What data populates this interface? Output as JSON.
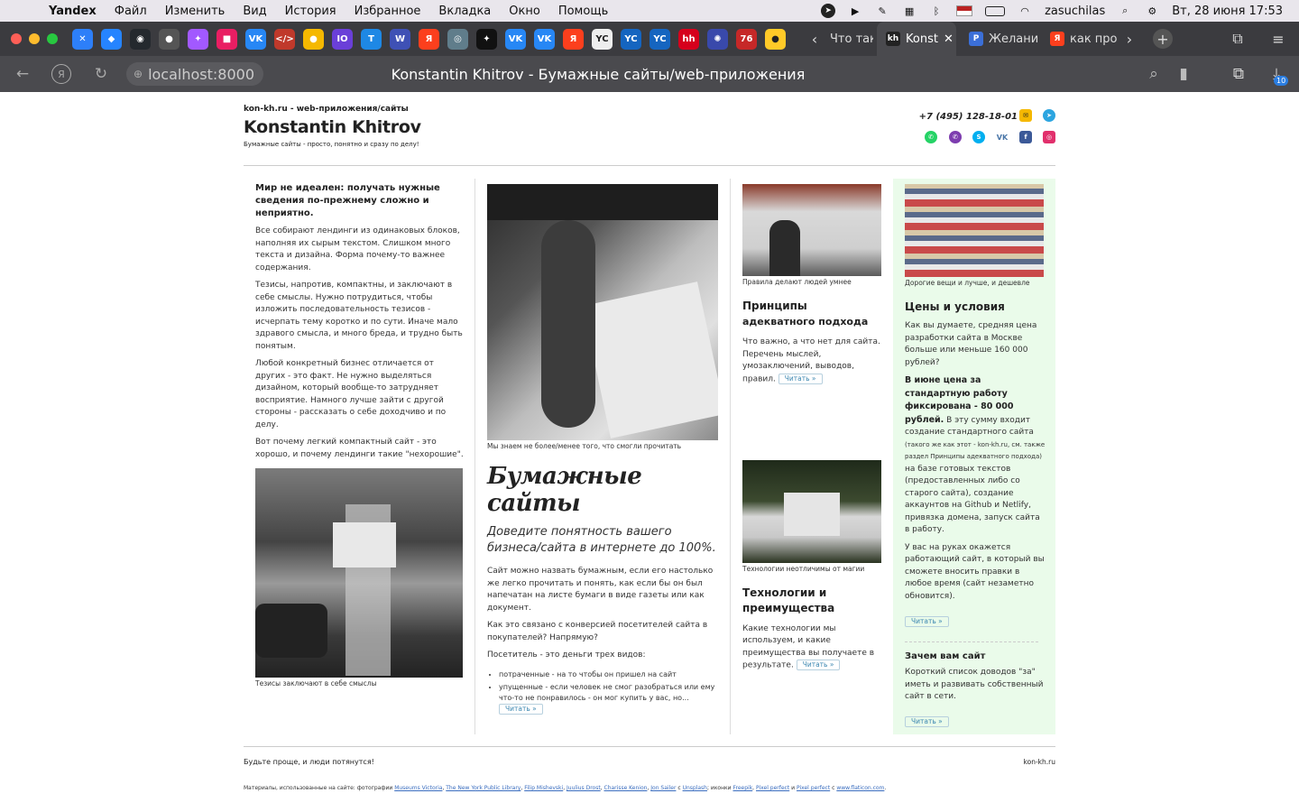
{
  "menubar": {
    "app": "Yandex",
    "items": [
      "Файл",
      "Изменить",
      "Вид",
      "История",
      "Избранное",
      "Вкладка",
      "Окно",
      "Помощь"
    ],
    "user": "zasuchilas",
    "datetime": "Вт, 28 июня  17:53"
  },
  "browser": {
    "tabs": [
      {
        "label": "Что так"
      },
      {
        "label": "Konst"
      },
      {
        "label": "Желани"
      },
      {
        "label": "как про"
      }
    ],
    "url": "localhost:8000",
    "page_title": "Konstantin Khitrov - Бумажные сайты/web-приложения",
    "downloads_badge": "10"
  },
  "site": {
    "domain_line": "kon-kh.ru - web-приложения/сайты",
    "name": "Konstantin Khitrov",
    "tagline": "Бумажные сайты - просто, понятно и сразу по делу!",
    "phone": "+7 (495) 128-18-01"
  },
  "col1": {
    "lead": "Мир не идеален: получать нужные сведения по-прежнему сложно и неприятно.",
    "p1": "Все собирают лендинги из одинаковых блоков, наполняя их сырым текстом. Слишком много текста и дизайна. Форма почему-то важнее содержания.",
    "p2": "Тезисы, напротив, компактны, и заключают в себе смыслы. Нужно потрудиться, чтобы изложить последовательность тезисов - исчерпать тему коротко и по сути. Иначе мало здравого смысла, и много бреда, и трудно быть понятым.",
    "p3": "Любой конкретный бизнес отличается от других - это факт. Не нужно выделяться дизайном, который вообще-то затрудняет восприятие. Намного лучше зайти с другой стороны - рассказать о себе доходчиво и по делу.",
    "p4": "Вот почему легкий компактный сайт - это хорошо, и почему лендинги такие \"нехорошие\".",
    "caption": "Тезисы заключают в себе смыслы"
  },
  "col2": {
    "caption": "Мы знаем не более/менее того, что смогли прочитать",
    "title": "Бумажные сайты",
    "subtitle": "Доведите понятность вашего бизнеса/сайта в интернете до 100%.",
    "p1": "Сайт можно назвать бумажным, если его настолько же легко прочитать и понять, как если бы он был напечатан на листе бумаги в виде газеты или как документ.",
    "p2": "Как это связано с конверсией посетителей сайта в покупателей? Напрямую?",
    "p3": "Посетитель - это деньги трех видов:",
    "li1": "потраченные - на то чтобы он пришел на сайт",
    "li2": "упущенные - если человек не смог разобраться или ему что-то не понравилось - он мог купить у вас, но...",
    "read": "Читать »"
  },
  "col3": {
    "caption1": "Правила делают людей умнее",
    "title1a": "Принципы",
    "title1b": "адекватного подхода",
    "p1": "Что важно, а что нет для сайта. Перечень мыслей, умозаключений, выводов, правил.",
    "read1": "Читать »",
    "caption2": "Технологии неотличимы от магии",
    "title2": "Технологии и преимущества",
    "p2": "Какие технологии мы используем, и какие преимущества вы получаете в результате.",
    "read2": "Читать »"
  },
  "col4": {
    "caption": "Дорогие вещи и лучше, и дешевле",
    "title": "Цены и условия",
    "p1": "Как вы думаете, средняя цена разработки сайта в Москве больше или меньше 160 000 рублей?",
    "p2_bold": "В июне цена за стандартную работу фиксирована - 80 000 рублей.",
    "p2_rest": " В эту сумму входит создание стандартного сайта ",
    "p2_small": "(такого же как этот - kon-kh.ru, см. также раздел Принципы адекватного подхода)",
    "p2_end": " на базе готовых текстов (предоставленных либо со старого сайта), создание аккаунтов на Github и Netlify, привязка домена, запуск сайта в работу.",
    "p3": "У вас на руках окажется работающий сайт, в который вы сможете вносить правки в любое время (сайт незаметно обновится).",
    "read1": "Читать »",
    "title2": "Зачем вам сайт",
    "p4": "Короткий список доводов \"за\" иметь и развивать собственный сайт в сети.",
    "read2": "Читать »"
  },
  "footer": {
    "left": "Будьте проще, и люди потянутся!",
    "right": "kon-kh.ru",
    "credits_prefix": "Материалы, использованные на сайте: фотографии",
    "links": [
      "Museums Victoria",
      "The New York Public Library",
      "Filip Mishevski",
      "Juulius Drost",
      "Charisse Kenion",
      "Jon Sailer",
      "Unsplash",
      "Freepik",
      "Pixel perfect",
      "Pixel perfect",
      "www.flaticon.com"
    ],
    "sep_c": "с",
    "sep_icons": "; иконки",
    "sep_and": "и"
  }
}
